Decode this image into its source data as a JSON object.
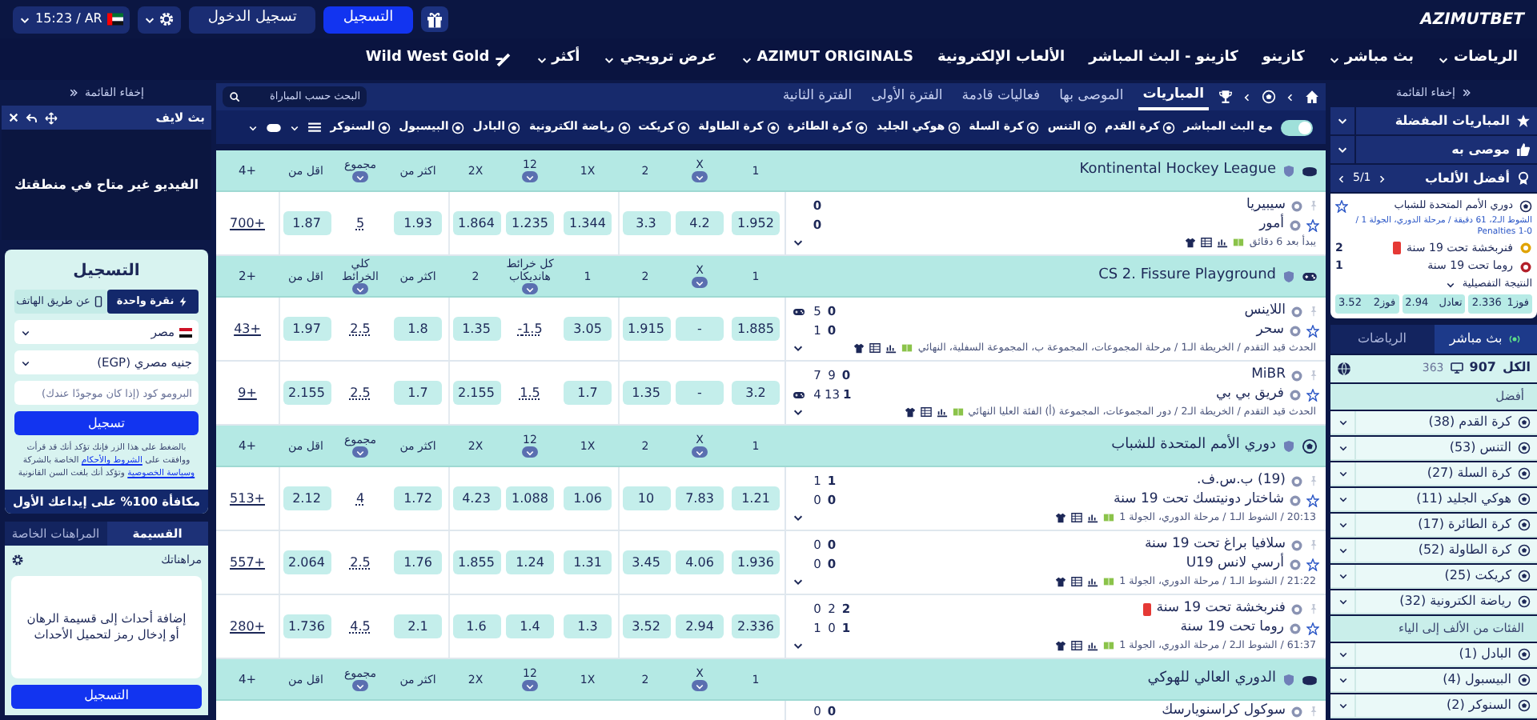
{
  "header": {
    "clock": "15:23 / AR",
    "login_button": "تسجيل الدخول",
    "register_button": "التسجيل",
    "logo": "AZIMUTBET"
  },
  "nav": [
    {
      "label": "الرياضات",
      "kind": "menu"
    },
    {
      "label": "بث مباشر",
      "kind": "menu"
    },
    {
      "label": "كازينو",
      "kind": "link"
    },
    {
      "label": "كازينو - البث المباشر",
      "kind": "link"
    },
    {
      "label": "الألعاب الإلكترونية",
      "kind": "link"
    },
    {
      "label": "AZIMUT ORIGINALS",
      "kind": "menu"
    },
    {
      "label": "عرض ترويجي",
      "kind": "menu"
    },
    {
      "label": "أكثر",
      "kind": "menu"
    },
    {
      "label": "Wild West Gold",
      "kind": "game"
    }
  ],
  "right_panel": {
    "hide_label": "إخفاء القائمة",
    "accordions": [
      {
        "label": "المباريات المفضلة"
      },
      {
        "label": "موصى به"
      }
    ],
    "top_games": {
      "title": "أفضل الألعاب",
      "pager": "5/1"
    },
    "featured": {
      "league": "دوري الأمم المتحدة للشباب",
      "status": "الشوط الـ2، 61 دقيقة / مرحلة الدوري، الجولة 1 / Penalties 1-0",
      "teams": [
        {
          "name": "فنربخشة تحت 19 سنة",
          "score": "2",
          "red_card": true
        },
        {
          "name": "روما تحت 19 سنة",
          "score": "1",
          "red_card": false
        }
      ],
      "details": "النتيجة التفصيلية",
      "odds": [
        {
          "label": "فوز1",
          "value": "2.336"
        },
        {
          "label": "تعادل",
          "value": "2.94"
        },
        {
          "label": "فوز2",
          "value": "3.52"
        }
      ]
    },
    "tabs": [
      {
        "label": "بث مباشر",
        "selected": true
      },
      {
        "label": "الرياضات",
        "selected": false
      }
    ],
    "counts": {
      "all_label": "الكل",
      "all_count": "907",
      "stream_count": "363"
    },
    "sections": [
      {
        "title": "أفضل",
        "items": [
          "كرة القدم (38)",
          "التنس (53)",
          "كرة السلة (27)",
          "هوكي الجليد (11)",
          "كرة الطائرة (17)",
          "كرة الطاولة (52)",
          "كريكت (25)",
          "رياضة الكترونية (32)"
        ]
      },
      {
        "title": "الفئات من الألف إلى الياء",
        "items": [
          "البادل (1)",
          "البيسبول (4)",
          "السنوكر (2)"
        ]
      }
    ]
  },
  "center": {
    "tabs": [
      {
        "label": "المباريات",
        "selected": true
      },
      {
        "label": "الموصى بها",
        "selected": false
      },
      {
        "label": "فعاليات قادمة",
        "selected": false
      },
      {
        "label": "الفترة الأولى",
        "selected": false
      },
      {
        "label": "الفترة الثانية",
        "selected": false
      }
    ],
    "search_placeholder": "البحث حسب المباراة",
    "live_toggle": {
      "label": "مع البث المباشر",
      "on": true
    },
    "sports": [
      "كرة القدم",
      "التنس",
      "كرة السلة",
      "هوكي الجليد",
      "كرة الطائرة",
      "كرة الطاولة",
      "كريكت",
      "رياضة الكترونية",
      "البادل",
      "البيسبول",
      "السنوكر"
    ],
    "rows": [
      {
        "kind": "league",
        "name": "Kontinental Hockey League",
        "columns": [
          "1",
          "X",
          "2",
          "1X",
          "12",
          "2X",
          "اكثر من",
          "مجموع",
          "اقل من"
        ],
        "more": "4+"
      },
      {
        "kind": "match",
        "teams": [
          {
            "name": "سيبيريا",
            "scores": [
              "0"
            ],
            "red_card": false,
            "active": false
          },
          {
            "name": "أمور",
            "scores": [
              "0"
            ],
            "red_card": false,
            "active": false
          }
        ],
        "info": "يبدأ بعد 6 دقائق",
        "odds": [
          {
            "kind": "odd",
            "value": "1.952"
          },
          {
            "kind": "odd",
            "value": "4.2"
          },
          {
            "kind": "odd",
            "value": "3.3"
          },
          {
            "kind": "odd",
            "value": "1.344"
          },
          {
            "kind": "odd",
            "value": "1.235"
          },
          {
            "kind": "odd",
            "value": "1.864"
          },
          {
            "kind": "odd",
            "value": "1.93"
          },
          {
            "kind": "line",
            "value": "5"
          },
          {
            "kind": "odd",
            "value": "1.87"
          }
        ],
        "more": "700+"
      },
      {
        "kind": "league",
        "name": "CS 2. Fissure Playground",
        "columns": [
          "1",
          "X",
          "2",
          "1",
          "كل خرائط هانديكاب",
          "2",
          "اكثر من",
          "كلي الخرائط",
          "اقل من"
        ],
        "more": "2+"
      },
      {
        "kind": "match",
        "teams": [
          {
            "name": "اللاينس",
            "scores": [
              "0",
              "5"
            ],
            "red_card": false,
            "active": true
          },
          {
            "name": "سحر",
            "scores": [
              "0",
              "1"
            ],
            "red_card": false,
            "active": false
          }
        ],
        "info": "الحدث قيد التقدم / الخريطة الـ1 / مرحلة المجموعات، المجموعة ب، المجموعة السفلية، النهائي",
        "odds": [
          {
            "kind": "odd",
            "value": "1.885"
          },
          {
            "kind": "odd",
            "value": "-"
          },
          {
            "kind": "odd",
            "value": "1.915"
          },
          {
            "kind": "odd",
            "value": "3.05"
          },
          {
            "kind": "line",
            "value": "1.5-"
          },
          {
            "kind": "odd",
            "value": "1.35"
          },
          {
            "kind": "odd",
            "value": "1.8"
          },
          {
            "kind": "line",
            "value": "2.5"
          },
          {
            "kind": "odd",
            "value": "1.97"
          }
        ],
        "more": "43+"
      },
      {
        "kind": "match",
        "teams": [
          {
            "name": "MiBR",
            "scores": [
              "0",
              "9",
              "7"
            ],
            "red_card": false,
            "active": false
          },
          {
            "name": "فريق بي بي",
            "scores": [
              "1",
              "13",
              "4"
            ],
            "red_card": false,
            "active": true
          }
        ],
        "info": "الحدث قيد التقدم / الخريطة الـ2 / دور المجموعات، المجموعة (أ) الفئة العليا النهائي",
        "odds": [
          {
            "kind": "odd",
            "value": "3.2"
          },
          {
            "kind": "odd",
            "value": "-"
          },
          {
            "kind": "odd",
            "value": "1.35"
          },
          {
            "kind": "odd",
            "value": "1.7"
          },
          {
            "kind": "line",
            "value": "1.5"
          },
          {
            "kind": "odd",
            "value": "2.155"
          },
          {
            "kind": "odd",
            "value": "1.7"
          },
          {
            "kind": "line",
            "value": "2.5"
          },
          {
            "kind": "odd",
            "value": "2.155"
          }
        ],
        "more": "9+"
      },
      {
        "kind": "league",
        "name": "دوري الأمم المتحدة للشباب",
        "columns": [
          "1",
          "X",
          "2",
          "1X",
          "12",
          "2X",
          "اكثر من",
          "مجموع",
          "اقل من"
        ],
        "more": "4+"
      },
      {
        "kind": "match",
        "teams": [
          {
            "name": "(19) ب.س.ف.",
            "scores": [
              "1",
              "1"
            ],
            "red_card": false,
            "active": false
          },
          {
            "name": "شاختار دونيتسك تحت 19 سنة",
            "scores": [
              "0",
              "0"
            ],
            "red_card": false,
            "active": false
          }
        ],
        "info": "20:13 / الشوط الـ1 / مرحلة الدوري، الجولة 1",
        "odds": [
          {
            "kind": "odd",
            "value": "1.21"
          },
          {
            "kind": "odd",
            "value": "7.83"
          },
          {
            "kind": "odd",
            "value": "10"
          },
          {
            "kind": "odd",
            "value": "1.06"
          },
          {
            "kind": "odd",
            "value": "1.088"
          },
          {
            "kind": "odd",
            "value": "4.23"
          },
          {
            "kind": "odd",
            "value": "1.72"
          },
          {
            "kind": "line",
            "value": "4"
          },
          {
            "kind": "odd",
            "value": "2.12"
          }
        ],
        "more": "513+"
      },
      {
        "kind": "match",
        "teams": [
          {
            "name": "سلافيا براغ تحت 19 سنة",
            "scores": [
              "0",
              "0"
            ],
            "red_card": false,
            "active": false
          },
          {
            "name": "أرسي لانس U19",
            "scores": [
              "0",
              "0"
            ],
            "red_card": false,
            "active": false
          }
        ],
        "info": "21:22 / الشوط الـ1 / مرحلة الدوري، الجولة 1",
        "odds": [
          {
            "kind": "odd",
            "value": "1.936"
          },
          {
            "kind": "odd",
            "value": "4.06"
          },
          {
            "kind": "odd",
            "value": "3.45"
          },
          {
            "kind": "odd",
            "value": "1.31"
          },
          {
            "kind": "odd",
            "value": "1.24"
          },
          {
            "kind": "odd",
            "value": "1.855"
          },
          {
            "kind": "odd",
            "value": "1.76"
          },
          {
            "kind": "line",
            "value": "2.5"
          },
          {
            "kind": "odd",
            "value": "2.064"
          }
        ],
        "more": "557+"
      },
      {
        "kind": "match",
        "teams": [
          {
            "name": "فنربخشة تحت 19 سنة",
            "scores": [
              "2",
              "2",
              "0"
            ],
            "red_card": true,
            "active": false
          },
          {
            "name": "روما تحت 19 سنة",
            "scores": [
              "1",
              "0",
              "1"
            ],
            "red_card": false,
            "active": false
          }
        ],
        "info": "61:37 / الشوط الـ2 / مرحلة الدوري، الجولة 1",
        "odds": [
          {
            "kind": "odd",
            "value": "2.336"
          },
          {
            "kind": "odd",
            "value": "2.94"
          },
          {
            "kind": "odd",
            "value": "3.52"
          },
          {
            "kind": "odd",
            "value": "1.3"
          },
          {
            "kind": "odd",
            "value": "1.4"
          },
          {
            "kind": "odd",
            "value": "1.6"
          },
          {
            "kind": "odd",
            "value": "2.1"
          },
          {
            "kind": "line",
            "value": "4.5"
          },
          {
            "kind": "odd",
            "value": "1.736"
          }
        ],
        "more": "280+"
      },
      {
        "kind": "league",
        "name": "الدوري العالي للهوكي",
        "columns": [
          "1",
          "X",
          "2",
          "1X",
          "12",
          "2X",
          "اكثر من",
          "مجموع",
          "اقل من"
        ],
        "more": "4+"
      },
      {
        "kind": "match",
        "teams": [
          {
            "name": "سوكول كراسنويارسك",
            "scores": [
              "0",
              "0"
            ],
            "red_card": false,
            "active": false
          }
        ]
      }
    ]
  },
  "left_panel": {
    "hide_label": "إخفاء القائمة",
    "live_title": "بث لايف",
    "video_message": "الفيديو غير متاح في منطقتك",
    "registration": {
      "title": "التسجيل",
      "tabs": [
        {
          "label": "نقرة واحدة",
          "selected": true
        },
        {
          "label": "عن طريق الهاتف",
          "selected": false
        }
      ],
      "country": "مصر",
      "currency": "جنيه مصري (EGP)",
      "promo_placeholder": "البرومو كود (إذا كان موجودًا عندك)",
      "submit": "تسجيل",
      "terms": [
        {
          "text": "بالضغط على هذا الزر فإنك تؤكد أنك قد قرأت ووافقت على ",
          "link": false
        },
        {
          "text": "الشروط والأحكام",
          "link": true
        },
        {
          "text": " الخاصة بالشركة ",
          "link": false
        },
        {
          "text": "وسياسة الخصوصية",
          "link": true
        },
        {
          "text": " وتؤكد أنك بلغت السن القانونية",
          "link": false
        }
      ]
    },
    "bonus": "مكافأة 100% على إيداعك الأول",
    "slip_tabs": [
      {
        "label": "القسيمة",
        "selected": true
      },
      {
        "label": "المراهنات الخاصة",
        "selected": false
      }
    ],
    "bets_title": "مراهناتك",
    "empty_message": "إضافة أحداث إلى قسيمة الرهان أو إدخال رمز لتحميل الأحداث",
    "slip_button": "التسجيل"
  }
}
